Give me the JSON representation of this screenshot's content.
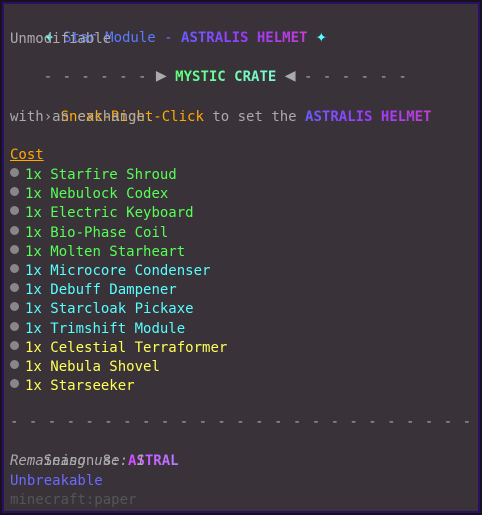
{
  "tooltip": {
    "title": {
      "star_glyph": "✦",
      "prefix": "Star Module - ",
      "item_name": "ASTRALIS HELMET"
    },
    "modifiable_note": "Unmodifiable",
    "crate_header": {
      "dashes_left": "- - - - - -",
      "arrow_right": "▶",
      "name": "MYSTIC CRATE",
      "arrow_left": "◀",
      "dashes_right": "- - - - - -"
    },
    "instruction": {
      "arrow": "›",
      "action": "Sneak-Right-Click",
      "middle": " to set the ",
      "item_name": "ASTRALIS HELMET",
      "line2": "with an exchange."
    },
    "cost_label": "Cost",
    "cost_items": [
      {
        "qty": "1x",
        "name": "Starfire Shroud",
        "color": "#55ff55"
      },
      {
        "qty": "1x",
        "name": "Nebulock Codex",
        "color": "#55ff55"
      },
      {
        "qty": "1x",
        "name": "Electric Keyboard",
        "color": "#55ff55"
      },
      {
        "qty": "1x",
        "name": "Bio-Phase Coil",
        "color": "#55ff55"
      },
      {
        "qty": "1x",
        "name": "Molten Starheart",
        "color": "#55ff55"
      },
      {
        "qty": "1x",
        "name": "Microcore Condenser",
        "color": "#55ffff"
      },
      {
        "qty": "1x",
        "name": "Debuff Dampener",
        "color": "#55ffff"
      },
      {
        "qty": "1x",
        "name": "Starcloak Pickaxe",
        "color": "#55ffff"
      },
      {
        "qty": "1x",
        "name": "Trimshift Module",
        "color": "#55ffff"
      },
      {
        "qty": "1x",
        "name": "Celestial Terraformer",
        "color": "#ffff55"
      },
      {
        "qty": "1x",
        "name": "Nebula Shovel",
        "color": "#ffff55"
      },
      {
        "qty": "1x",
        "name": "Starseeker",
        "color": "#ffff55"
      }
    ],
    "separator": "- - - - - - - - - - - - - - - - - - - - - - - - -",
    "season": {
      "label": "Season 8: ",
      "value": "ASTRAL"
    },
    "remaining_uses": "Remaining use: 1",
    "unbreakable": "Unbreakable",
    "item_id": "minecraft:paper"
  }
}
